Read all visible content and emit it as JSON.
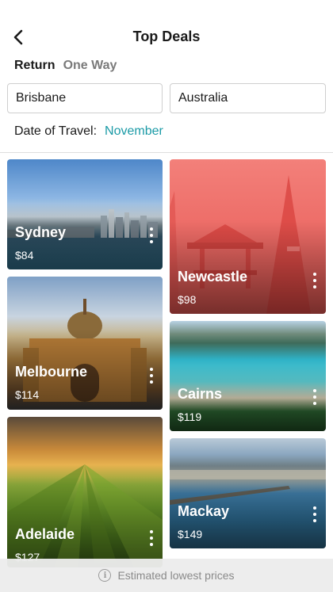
{
  "header": {
    "title": "Top Deals",
    "back_icon": "chevron-left-icon"
  },
  "tabs": [
    {
      "label": "Return",
      "active": true
    },
    {
      "label": "One Way",
      "active": false
    }
  ],
  "search": {
    "from_value": "Brisbane",
    "to_value": "Australia"
  },
  "date": {
    "label": "Date of Travel:",
    "value": "November",
    "accent_color": "#1a9aa6"
  },
  "deals": [
    {
      "name": "Sydney",
      "price": "$84"
    },
    {
      "name": "Newcastle",
      "price": "$98"
    },
    {
      "name": "Melbourne",
      "price": "$114"
    },
    {
      "name": "Cairns",
      "price": "$119"
    },
    {
      "name": "Adelaide",
      "price": "$127"
    },
    {
      "name": "Mackay",
      "price": "$149"
    }
  ],
  "footer": {
    "note": "Estimated lowest prices",
    "info_icon": "info-icon"
  }
}
